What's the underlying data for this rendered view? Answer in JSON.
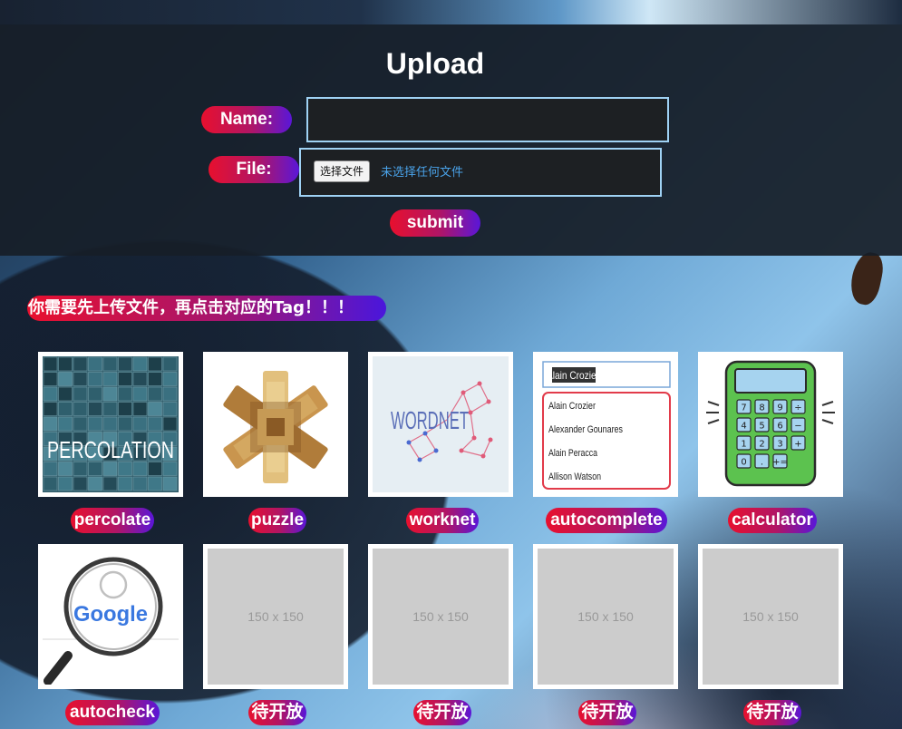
{
  "upload": {
    "title": "Upload",
    "name_label": "Name:",
    "name_value": "",
    "file_label": "File:",
    "file_button": "选择文件",
    "file_status": "未选择任何文件",
    "submit_label": "submit"
  },
  "notice": "你需要先上传文件，再点击对应的Tag！！！",
  "cards": [
    {
      "tag": "percolate",
      "image_text": "PERCOLATION",
      "icon": "percolation-grid-image"
    },
    {
      "tag": "puzzle",
      "icon": "wooden-burr-puzzle-image"
    },
    {
      "tag": "worknet",
      "image_text": "WORDNET",
      "icon": "wordnet-graph-image"
    },
    {
      "tag": "autocomplete",
      "icon": "autocomplete-dropdown-image",
      "input_text": "Alain Crozier",
      "options": [
        "Alain Crozier",
        "Alexander Gounares",
        "Alain Peracca",
        "Allison Watson"
      ]
    },
    {
      "tag": "calculator",
      "icon": "calculator-image",
      "keys": [
        "7",
        "8",
        "9",
        "÷",
        "4",
        "5",
        "6",
        "−",
        "1",
        "2",
        "3",
        "+",
        "0",
        ".",
        "+="
      ]
    },
    {
      "tag": "autocheck",
      "image_text": "Google",
      "icon": "google-magnifier-image"
    },
    {
      "tag": "待开放",
      "placeholder": "150 x 150"
    },
    {
      "tag": "待开放",
      "placeholder": "150 x 150"
    },
    {
      "tag": "待开放",
      "placeholder": "150 x 150"
    },
    {
      "tag": "待开放",
      "placeholder": "150 x 150"
    }
  ],
  "colors": {
    "pill_start": "#e8102e",
    "pill_end": "#5a16d8",
    "input_border": "#9fd2f4",
    "panel_bg": "#171e28",
    "file_status": "#4aa3ea"
  }
}
